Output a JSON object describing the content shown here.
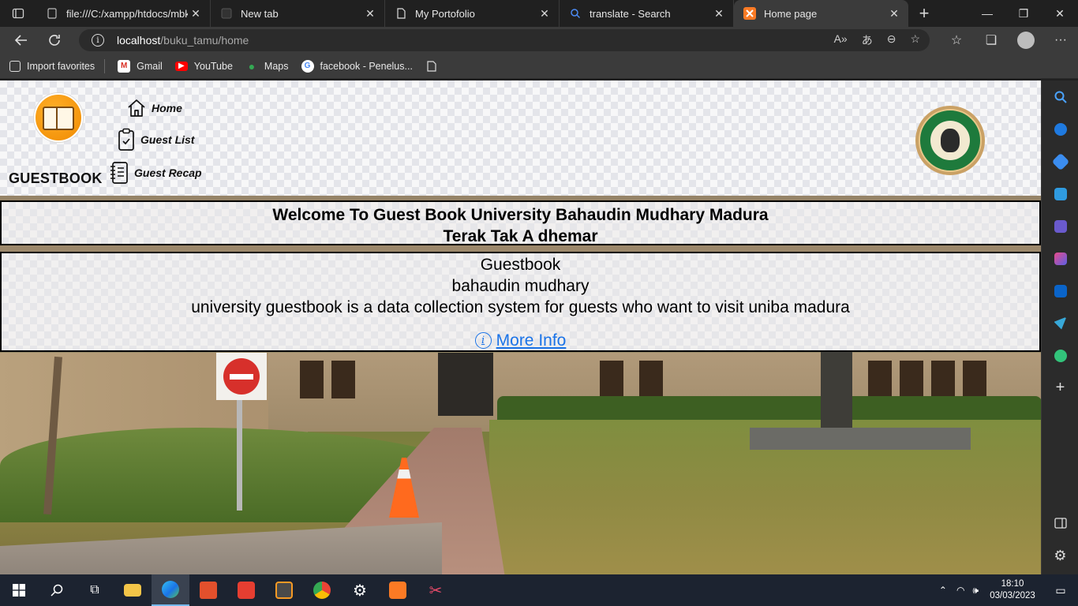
{
  "browser": {
    "tabs": [
      {
        "title": "file:///C:/xampp/htdocs/mbkm",
        "icon": "file-icon"
      },
      {
        "title": "New tab",
        "icon": "newtab-icon"
      },
      {
        "title": "My Portofolio",
        "icon": "document-icon"
      },
      {
        "title": "translate - Search",
        "icon": "search-icon"
      },
      {
        "title": "Home page",
        "icon": "xampp-icon",
        "active": true
      }
    ],
    "url_host": "localhost",
    "url_path": "/buku_tamu/home",
    "favorites": [
      {
        "label": "Import favorites"
      },
      {
        "label": "Gmail"
      },
      {
        "label": "YouTube"
      },
      {
        "label": "Maps"
      },
      {
        "label": "facebook - Penelus..."
      }
    ]
  },
  "site": {
    "brand": "GUESTBOOK",
    "nav": [
      {
        "label": "Home",
        "icon": "home-icon"
      },
      {
        "label": "Guest List",
        "icon": "clipboard-icon"
      },
      {
        "label": "Guest Recap",
        "icon": "notebook-icon"
      }
    ],
    "welcome_line1": "Welcome To Guest Book University Bahaudin Mudhary Madura",
    "welcome_line2": "Terak Tak A dhemar",
    "info_title": "Guestbook",
    "info_subtitle": "bahaudin mudhary",
    "info_description": "university guestbook is a data collection system for guests who want to visit uniba madura",
    "more_info": "More Info"
  },
  "taskbar": {
    "time": "18:10",
    "date": "03/03/2023"
  },
  "colors": {
    "link": "#1a73e8",
    "logo_orange": "#f08a00",
    "emblem_green": "#1e7a3c",
    "tab_bg": "#202020",
    "toolbar_bg": "#3b3b3b",
    "taskbar_bg": "#1c2330"
  }
}
